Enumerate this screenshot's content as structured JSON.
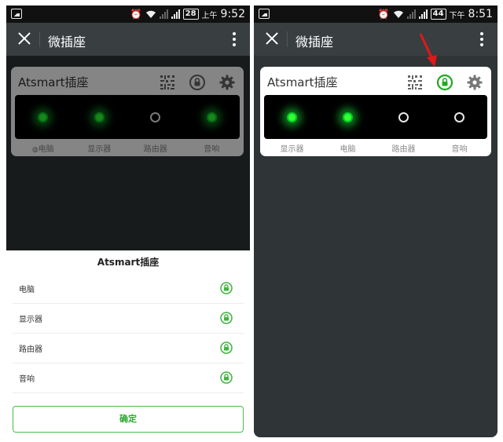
{
  "left": {
    "status": {
      "battery": "28",
      "ampm": "上午",
      "time": "9:52"
    },
    "nav_title": "微插座",
    "card": {
      "title": "Atsmart插座",
      "outlets": [
        {
          "label": "电脑",
          "on": true
        },
        {
          "label": "显示器",
          "on": true
        },
        {
          "label": "路由器",
          "on": false
        },
        {
          "label": "音响",
          "on": true
        }
      ]
    },
    "sheet": {
      "title": "Atsmart插座",
      "items": [
        {
          "label": "电脑",
          "icon": "lock-icon"
        },
        {
          "label": "显示器",
          "icon": "lock-icon"
        },
        {
          "label": "路由器",
          "icon": "lock-icon"
        },
        {
          "label": "音响",
          "icon": "lock-icon"
        }
      ],
      "confirm_label": "确定"
    }
  },
  "right": {
    "status": {
      "battery": "44",
      "ampm": "下午",
      "time": "8:51"
    },
    "nav_title": "微插座",
    "card": {
      "title": "Atsmart插座",
      "outlets": [
        {
          "label": "显示器",
          "on": true
        },
        {
          "label": "电脑",
          "on": true
        },
        {
          "label": "路由器",
          "on": false
        },
        {
          "label": "音响",
          "on": false
        }
      ]
    }
  },
  "colors": {
    "accent_green": "#2aa82a",
    "glow_green": "#33ff33",
    "annotation_red": "#e01818",
    "page_bg": "#2f3437",
    "navbar_bg": "#393e41"
  }
}
